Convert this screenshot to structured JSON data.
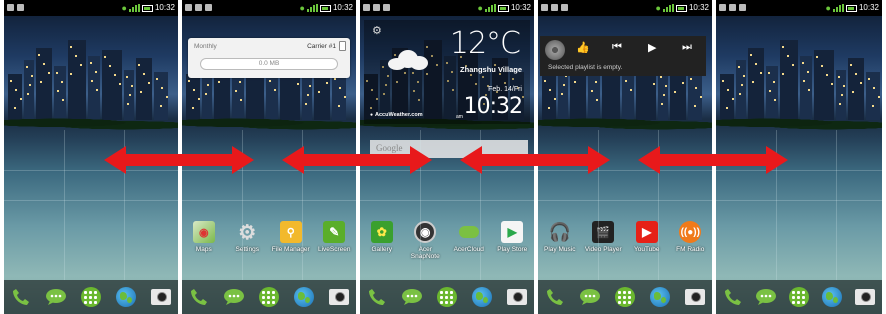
{
  "status": {
    "time": "10:32"
  },
  "panel2": {
    "widget": {
      "title": "Monthly",
      "carrier": "Carrier #1",
      "usage": "0.0 MB"
    },
    "apps": [
      {
        "label": "Maps"
      },
      {
        "label": "Settings"
      },
      {
        "label": "File Manager"
      },
      {
        "label": "LiveScreen"
      }
    ]
  },
  "panel3": {
    "weather": {
      "temperature": "12°C",
      "city": "Zhangshu Village",
      "date": "Feb. 14/Fri",
      "ampm": "am",
      "time": "10:32",
      "provider": "AccuWeather.com"
    },
    "search": {
      "text": "Google"
    },
    "apps": [
      {
        "label": "Gallery"
      },
      {
        "label": "Acer SnapNote"
      },
      {
        "label": "AcerCloud"
      },
      {
        "label": "Play Store"
      }
    ]
  },
  "panel4": {
    "music": {
      "message": "Selected playlist is empty."
    },
    "apps": [
      {
        "label": "Play Music"
      },
      {
        "label": "Video Player"
      },
      {
        "label": "YouTube"
      },
      {
        "label": "FM Radio"
      }
    ]
  },
  "dock": [
    "phone-icon",
    "messaging-icon",
    "app-drawer-icon",
    "browser-icon",
    "camera-icon"
  ],
  "colors": {
    "arrow": "#e8191b",
    "accent_green": "#6bb82f"
  }
}
